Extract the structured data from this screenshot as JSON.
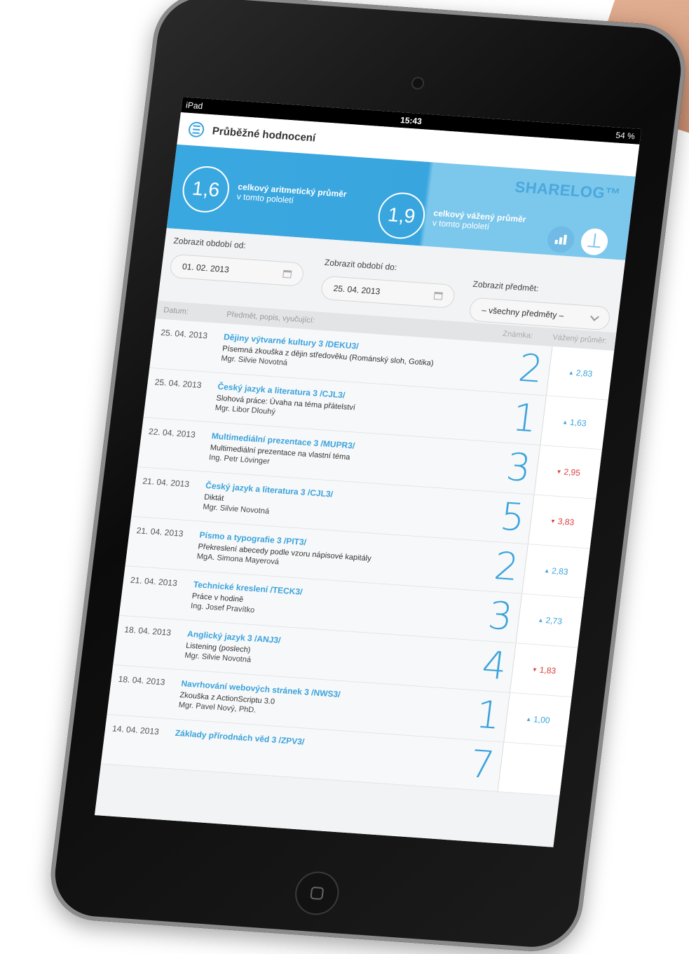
{
  "status_bar": {
    "carrier": "iPad",
    "time": "15:43",
    "battery": "54 %"
  },
  "app": {
    "title": "Průběžné hodnocení",
    "brand": "SHARELOG™"
  },
  "averages": [
    {
      "value": "1,6",
      "title": "celkový aritmetický průměr",
      "subtitle": "v tomto pololetí"
    },
    {
      "value": "1,9",
      "title": "celkový vážený průměr",
      "subtitle": "v tomto pololetí"
    }
  ],
  "icons": {
    "menu": "menu-icon",
    "chart": "bar-chart-icon",
    "scale": "scale-icon",
    "calendar": "calendar-icon",
    "chevron": "chevron-down-icon"
  },
  "filters": {
    "from": {
      "label": "Zobrazit období od:",
      "value": "01. 02. 2013"
    },
    "to": {
      "label": "Zobrazit období do:",
      "value": "25. 04. 2013"
    },
    "subject": {
      "label": "Zobrazit předmět:",
      "value": "– všechny předměty –"
    }
  },
  "table": {
    "headers": {
      "date": "Datum:",
      "subject": "Předmět, popis, vyučující:",
      "grade": "Známka:",
      "weighted": "Vážený průměr:"
    },
    "rows": [
      {
        "date": "25. 04. 2013",
        "subject": "Dějiny výtvarné kultury 3 /DEKU3/",
        "desc": "Písemná zkouška z dějin středověku (Románský sloh, Gotika)",
        "teacher": "Mgr. Silvie Novotná",
        "grade": "2",
        "weighted": "2,83",
        "trend": "up"
      },
      {
        "date": "25. 04. 2013",
        "subject": "Český jazyk a literatura 3 /CJL3/",
        "desc": "Slohová práce: Úvaha na téma přátelství",
        "teacher": "Mgr. Libor Dlouhý",
        "grade": "1",
        "weighted": "1,63",
        "trend": "up"
      },
      {
        "date": "22. 04. 2013",
        "subject": "Multimediální prezentace 3 /MUPR3/",
        "desc": "Multimediální prezentace na vlastní téma",
        "teacher": "Ing. Petr Lövinger",
        "grade": "3",
        "weighted": "2,95",
        "trend": "down"
      },
      {
        "date": "21. 04. 2013",
        "subject": "Český jazyk a literatura 3 /CJL3/",
        "desc": "Diktát",
        "teacher": "Mgr. Silvie Novotná",
        "grade": "5",
        "weighted": "3,83",
        "trend": "down"
      },
      {
        "date": "21. 04. 2013",
        "subject": "Písmo a typografie 3 /PIT3/",
        "desc": "Překreslení abecedy podle vzoru nápisové kapitály",
        "teacher": "MgA. Simona Mayerová",
        "grade": "2",
        "weighted": "2,83",
        "trend": "up"
      },
      {
        "date": "21. 04. 2013",
        "subject": "Technické kreslení /TECK3/",
        "desc": "Práce v hodině",
        "teacher": "Ing. Josef Pravítko",
        "grade": "3",
        "weighted": "2,73",
        "trend": "up"
      },
      {
        "date": "18. 04. 2013",
        "subject": "Anglický jazyk 3 /ANJ3/",
        "desc": "Listening (poslech)",
        "teacher": "Mgr. Silvie Novotná",
        "grade": "4",
        "weighted": "1,83",
        "trend": "down"
      },
      {
        "date": "18. 04. 2013",
        "subject": "Navrhování webových stránek 3 /NWS3/",
        "desc": "Zkouška z ActionScriptu 3.0",
        "teacher": "Mgr. Pavel Nový, PhD.",
        "grade": "1",
        "weighted": "1,00",
        "trend": "up"
      },
      {
        "date": "14. 04. 2013",
        "subject": "Základy přírodnách věd 3 /ZPV3/",
        "desc": "",
        "teacher": "",
        "grade": "7",
        "weighted": "",
        "trend": ""
      }
    ]
  },
  "colors": {
    "accent": "#3aa3dd",
    "down": "#e03b3b",
    "banner": "#3aa8e0"
  }
}
